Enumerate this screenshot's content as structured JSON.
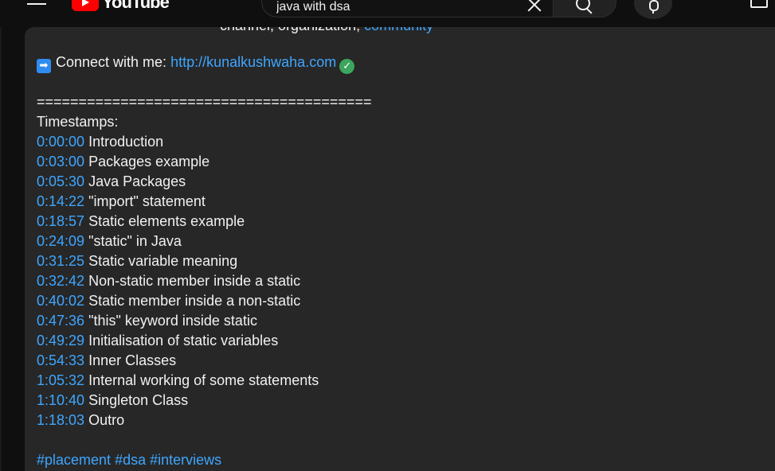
{
  "header": {
    "logo_text": "YouTube",
    "search_value": "java with dsa"
  },
  "description": {
    "cut_off_line_start": "channel, organization, ",
    "cut_off_line_link": "community",
    "connect_label": "Connect with me:",
    "connect_link": "http://kunalkushwaha.com",
    "separator": "========================================",
    "timestamps_heading": "Timestamps:",
    "timestamps": [
      {
        "time": "0:00:00",
        "title": "Introduction"
      },
      {
        "time": "0:03:00",
        "title": "Packages example"
      },
      {
        "time": "0:05:30",
        "title": "Java Packages"
      },
      {
        "time": "0:14:22",
        "title": "\"import\" statement"
      },
      {
        "time": "0:18:57",
        "title": "Static elements example"
      },
      {
        "time": "0:24:09",
        "title": "\"static\" in Java"
      },
      {
        "time": "0:31:25",
        "title": "Static variable meaning"
      },
      {
        "time": "0:32:42",
        "title": "Non-static member inside a static"
      },
      {
        "time": "0:40:02",
        "title": "Static member inside a non-static"
      },
      {
        "time": "0:47:36",
        "title": "\"this\" keyword inside static"
      },
      {
        "time": "0:49:29",
        "title": "Initialisation of static variables"
      },
      {
        "time": "0:54:33",
        "title": "Inner Classes"
      },
      {
        "time": "1:05:32",
        "title": "Internal working of some statements"
      },
      {
        "time": "1:10:40",
        "title": "Singleton Class"
      },
      {
        "time": "1:18:03",
        "title": "Outro"
      }
    ],
    "hashtags": [
      "#placement",
      "#dsa",
      "#interviews"
    ]
  },
  "colors": {
    "link": "#3ea6ff",
    "panel_bg": "#272727",
    "page_bg": "#0f0f0f",
    "check_green": "#3ba55d",
    "arrow_blue": "#2e8cf0"
  },
  "icons": [
    "menu-icon",
    "youtube-logo-icon",
    "clear-icon",
    "search-icon",
    "mic-icon",
    "create-icon",
    "right-arrow-icon",
    "check-mark-icon"
  ]
}
